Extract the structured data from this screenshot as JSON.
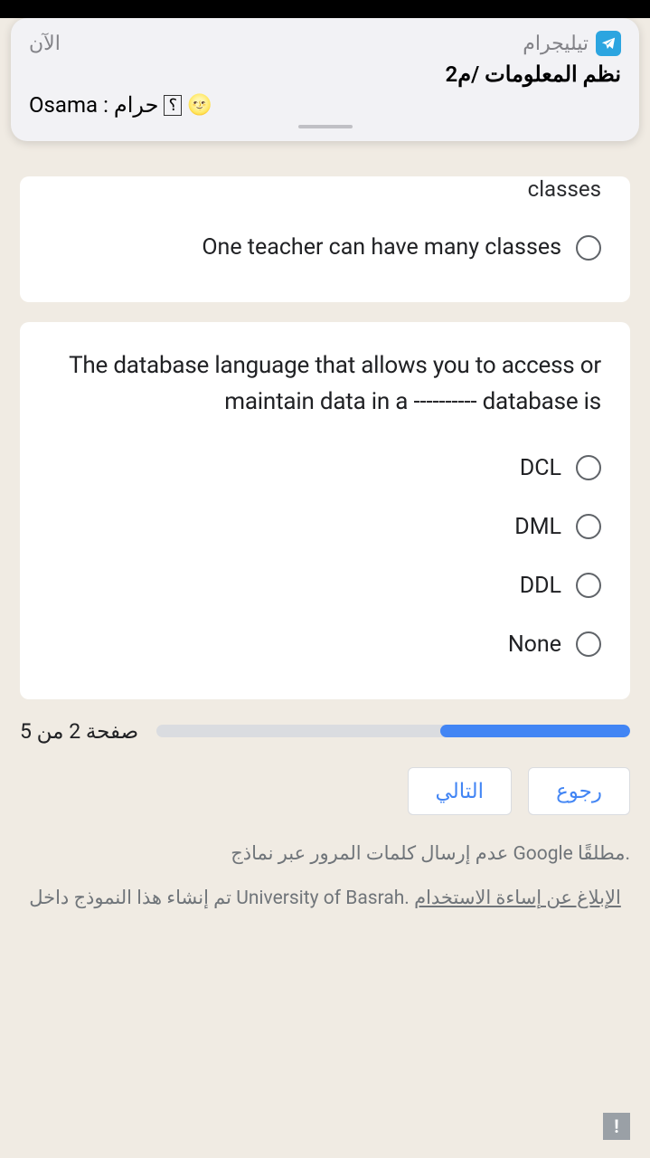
{
  "notification": {
    "app_name": "تيليجرام",
    "time": "الآن",
    "title": "نظم المعلومات /م2",
    "sender": "Osama",
    "message": "حرام",
    "symbol": "؟",
    "emoji": "🌝"
  },
  "question1": {
    "partial_text": "classes",
    "option": "One teacher can have many classes"
  },
  "question2": {
    "text": "The database language that allows you to access or maintain data in a ---------- database is",
    "options": [
      "DCL",
      "DML",
      "DDL",
      "None"
    ]
  },
  "progress": {
    "label": "صفحة 2 من 5"
  },
  "nav": {
    "next": "التالي",
    "back": "رجوع"
  },
  "footer": {
    "text1": "عدم إرسال كلمات المرور عبر نماذج Google مطلقًا.",
    "text2_pre": "تم إنشاء هذا النموذج داخل University of Basrah. ",
    "report": "الإبلاغ عن إساءة الاستخدام"
  }
}
